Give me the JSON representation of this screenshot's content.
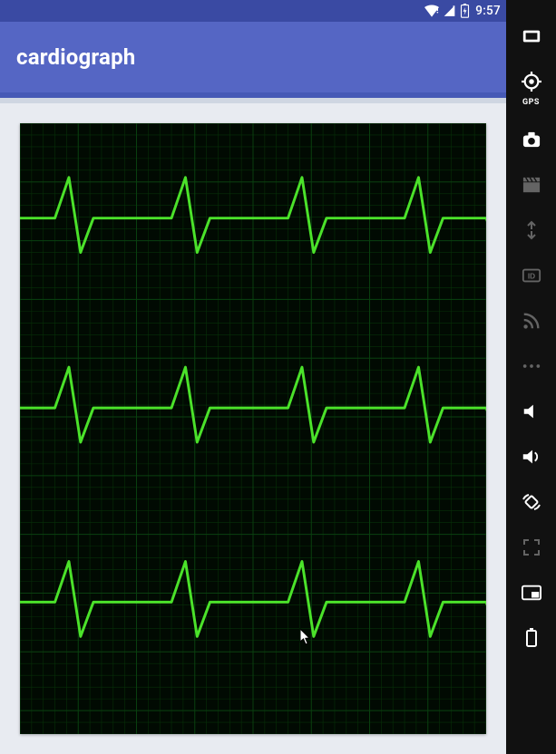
{
  "status": {
    "time": "9:57",
    "wifi_full": true,
    "cell_signal": true,
    "battery_charging": true
  },
  "app": {
    "title": "cardiograph"
  },
  "cardio": {
    "bg_color": "#010a02",
    "grid_color_major": "#0a4010",
    "grid_color_minor": "#073008",
    "trace_color": "#4be22a",
    "trace_width": 3,
    "rows": 3,
    "beats_per_row": 4
  },
  "emulator_toolbar": {
    "items": [
      {
        "name": "power",
        "label": "",
        "active": true
      },
      {
        "name": "gps",
        "label": "GPS",
        "active": true
      },
      {
        "name": "camera",
        "label": "",
        "active": true
      },
      {
        "name": "clapper",
        "label": "",
        "active": false
      },
      {
        "name": "network",
        "label": "",
        "active": false
      },
      {
        "name": "identifiers",
        "label": "",
        "active": false
      },
      {
        "name": "rss",
        "label": "",
        "active": false
      },
      {
        "name": "more",
        "label": "",
        "active": false
      },
      {
        "name": "volume-down",
        "label": "",
        "active": true
      },
      {
        "name": "volume-up",
        "label": "",
        "active": true
      },
      {
        "name": "rotate",
        "label": "",
        "active": true
      },
      {
        "name": "fullscreen",
        "label": "",
        "active": false
      },
      {
        "name": "pip",
        "label": "",
        "active": true
      },
      {
        "name": "battery",
        "label": "",
        "active": true
      }
    ]
  }
}
